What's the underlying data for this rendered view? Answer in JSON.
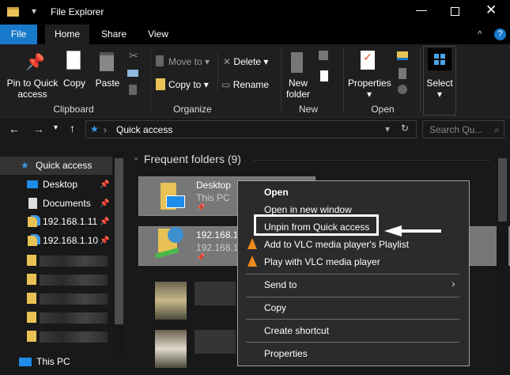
{
  "window": {
    "title": "File Explorer"
  },
  "tabs": [
    {
      "label": "File"
    },
    {
      "label": "Home"
    },
    {
      "label": "Share"
    },
    {
      "label": "View"
    }
  ],
  "ribbon": {
    "clipboard": {
      "pin": "Pin to Quick access",
      "copy": "Copy",
      "paste": "Paste",
      "group": "Clipboard"
    },
    "organize": {
      "move_to": "Move to",
      "copy_to": "Copy to",
      "delete": "Delete",
      "rename": "Rename",
      "group": "Organize"
    },
    "new": {
      "new_folder": "New folder",
      "group": "New"
    },
    "open": {
      "properties": "Properties",
      "group": "Open"
    },
    "select": {
      "label": "Select"
    }
  },
  "address": {
    "path": "Quick access",
    "search_placeholder": "Search Qu..."
  },
  "sidebar": {
    "items": [
      {
        "label": "Quick access"
      },
      {
        "label": "Desktop"
      },
      {
        "label": "Documents"
      },
      {
        "label": "192.168.1.11"
      },
      {
        "label": "192.168.1.10"
      },
      {
        "label": "This PC"
      }
    ]
  },
  "content": {
    "section": "Frequent folders (9)",
    "folders": [
      {
        "name": "Desktop",
        "location": "This PC"
      },
      {
        "name": "192.168.1.",
        "location": "192.168.1."
      }
    ]
  },
  "context_menu": {
    "items": [
      "Open",
      "Open in new window",
      "Unpin from Quick access",
      "Add to VLC media player's Playlist",
      "Play with VLC media player",
      "Send to",
      "Copy",
      "Create shortcut",
      "Properties"
    ]
  },
  "colors": {
    "file_tab": "#1979ca",
    "accent": "#0078d7",
    "highlight_box": "#ffffff"
  }
}
